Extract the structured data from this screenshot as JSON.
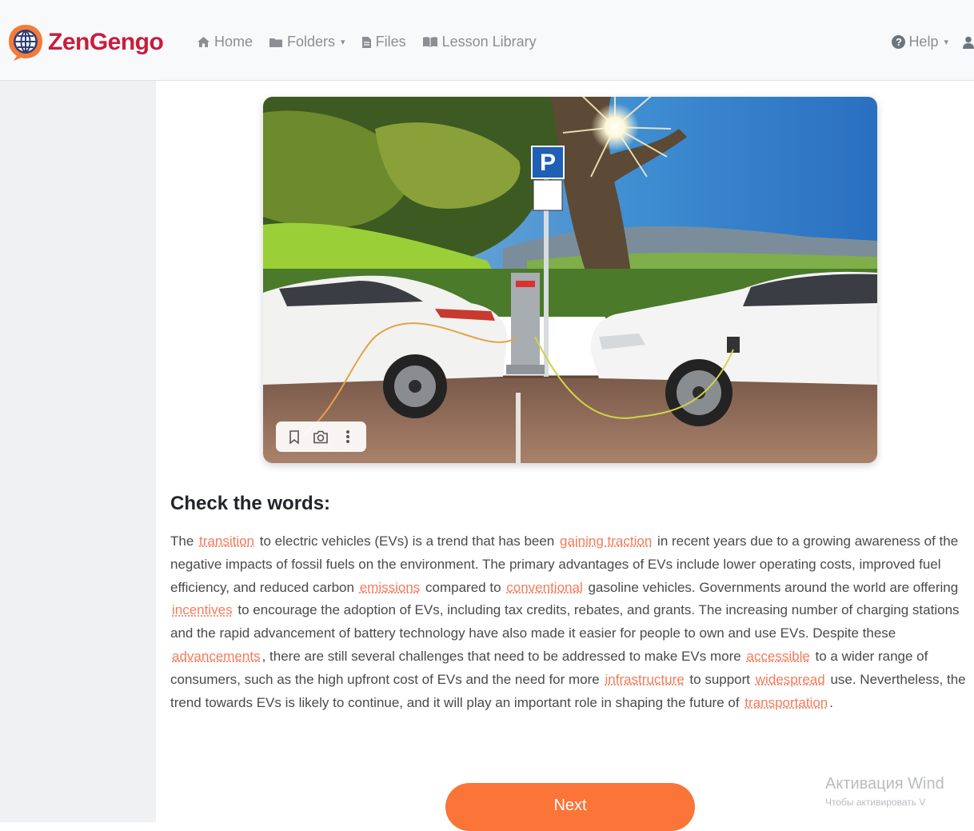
{
  "brand": {
    "name": "ZenGengo"
  },
  "nav": {
    "home": "Home",
    "folders": "Folders",
    "files": "Files",
    "lesson_library": "Lesson Library",
    "help": "Help",
    "caret": "▾"
  },
  "icons": {
    "home": "home-icon",
    "folders": "folder-icon",
    "files": "file-icon",
    "lesson_library": "book-icon",
    "help": "help-circle-icon",
    "user": "user-icon",
    "bookmark": "bookmark-icon",
    "camera": "camera-icon",
    "more": "more-vertical-icon"
  },
  "colors": {
    "brand": "#c81d3c",
    "vocab_highlight": "#f47b5c",
    "button": "#fb7438"
  },
  "section": {
    "title": "Check the words:"
  },
  "passage": {
    "t01": "The",
    "w01": "transition",
    "t02": "to electric vehicles (EVs) is a trend that has been",
    "w02": "gaining traction",
    "t03": "in recent years due to a growing awareness of the negative impacts of fossil fuels on the environment. The primary advantages of EVs include lower operating costs, improved fuel efficiency, and reduced carbon",
    "w03": "emissions",
    "t04": "compared to",
    "w04": "conventional",
    "t05": "gasoline vehicles. Governments around the world are offering",
    "w05": "incentives",
    "t06": "to encourage the adoption of EVs, including tax credits, rebates, and grants. The increasing number of charging stations and the rapid advancement of battery technology have also made it easier for people to own and use EVs. Despite these",
    "w06": "advancements",
    "t07": ", there are still several challenges that need to be addressed to make EVs more",
    "w07": "accessible",
    "t08": "to a wider range of consumers, such as the high upfront cost of EVs and the need for more",
    "w08": "infrastructure",
    "t09": "to support",
    "w09": "widespread",
    "t10": "use. Nevertheless, the trend towards EVs is likely to continue, and it will play an important role in shaping the future of",
    "w10": "transportation",
    "t11": "."
  },
  "buttons": {
    "next": "Next"
  },
  "hero_sign": {
    "letter": "P"
  },
  "watermark": {
    "line1": "Активация Wind",
    "line2": "Чтобы активировать V"
  }
}
